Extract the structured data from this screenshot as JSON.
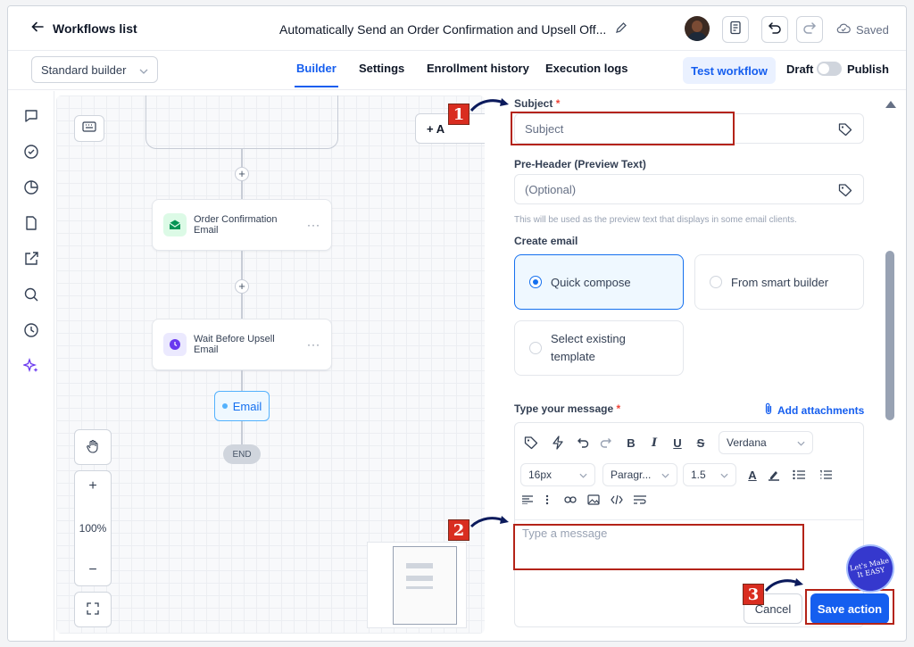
{
  "header": {
    "back_label": "Workflows list",
    "workflow_title": "Automatically Send an Order Confirmation and Upsell Off...",
    "saved_label": "Saved"
  },
  "subnav": {
    "builder_select": "Standard builder",
    "tabs": [
      "Builder",
      "Settings",
      "Enrollment history",
      "Execution logs"
    ],
    "active_tab": "Builder",
    "test_workflow": "Test workflow",
    "draft_label": "Draft",
    "publish_label": "Publish"
  },
  "canvas": {
    "add_label": "+ A",
    "nodes": [
      {
        "label": "Order Confirmation Email",
        "icon": "email-icon",
        "color": "#079455"
      },
      {
        "label": "Wait Before Upsell Email",
        "icon": "clock-icon",
        "color": "#6938ef"
      }
    ],
    "email_pill": "Email",
    "end_label": "END",
    "zoom_label": "100%"
  },
  "panel": {
    "subject_label": "Subject",
    "subject_placeholder": "Subject",
    "preheader_label": "Pre-Header (Preview Text)",
    "preheader_placeholder": "(Optional)",
    "preheader_hint": "This will be used as the preview text that displays in some email clients.",
    "create_email_label": "Create email",
    "options": [
      {
        "label": "Quick compose",
        "selected": true
      },
      {
        "label": "From smart builder",
        "selected": false
      },
      {
        "label": "Select existing template",
        "selected": false
      }
    ],
    "message_label": "Type your message",
    "add_attachments": "Add attachments",
    "font_family": "Verdana",
    "font_size": "16px",
    "block_format": "Paragr...",
    "line_height": "1.5",
    "message_placeholder": "Type a message",
    "cancel_label": "Cancel",
    "save_label": "Save action"
  },
  "annotations": {
    "badges": [
      "1",
      "2",
      "3"
    ],
    "logo_text": "Let's Make It EASY"
  },
  "colors": {
    "accent": "#155eef",
    "highlight": "#b42318"
  }
}
